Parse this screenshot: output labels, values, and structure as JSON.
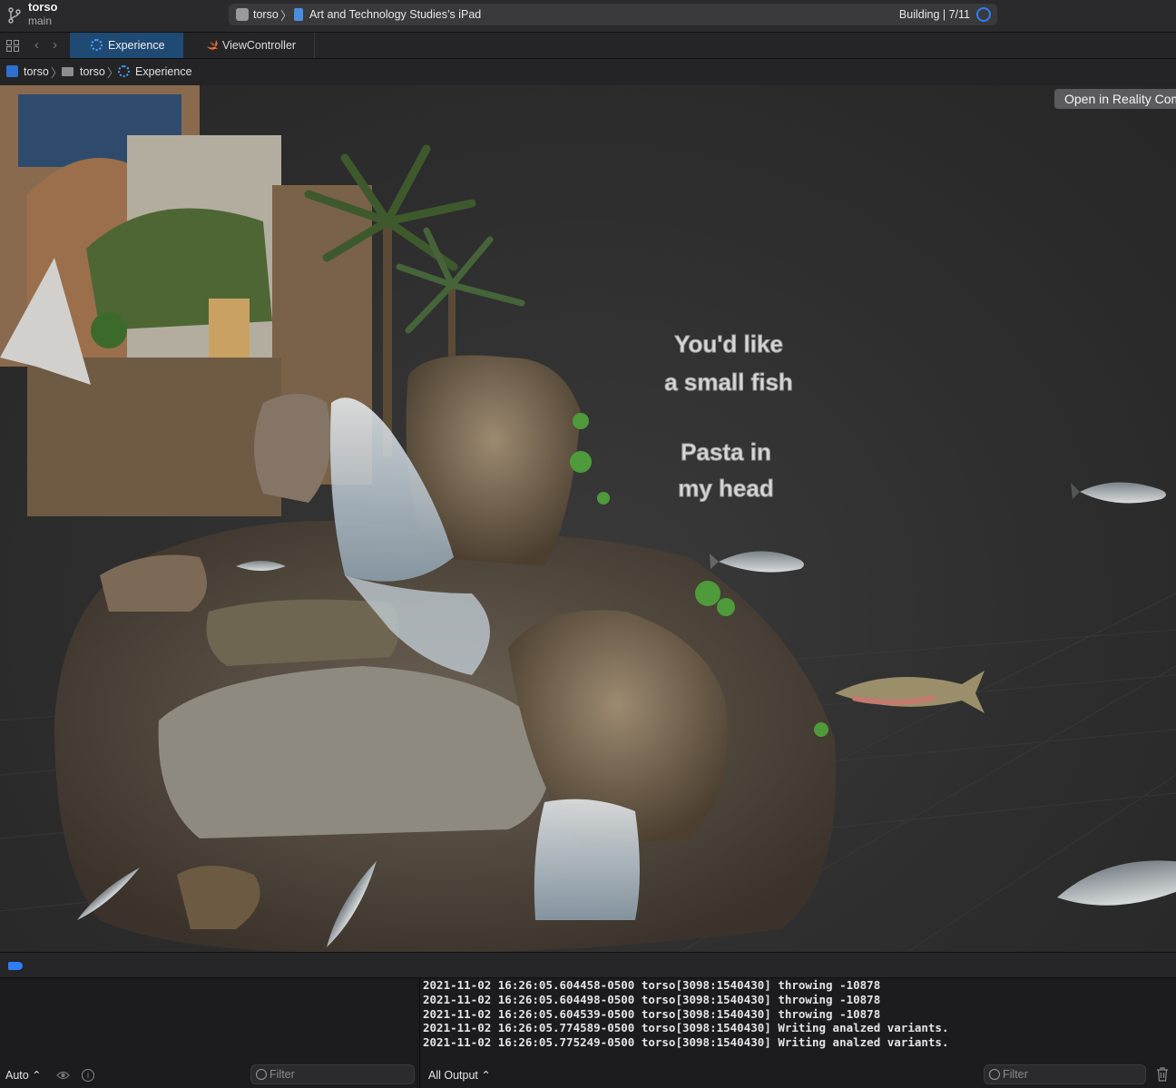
{
  "toolbar": {
    "project_name": "torso",
    "branch": "main",
    "scheme": "torso",
    "device": "Art and Technology Studies’s iPad",
    "build_status": "Building | 7/11"
  },
  "tabs": [
    {
      "label": "Experience",
      "icon": "reality-composer-icon",
      "active": true
    },
    {
      "label": "ViewController",
      "icon": "swift-icon",
      "active": false
    }
  ],
  "breadcrumb": [
    "torso",
    "torso",
    "Experience"
  ],
  "viewport": {
    "open_button_label": "Open in Reality Composer",
    "scene_text": [
      "You'd like",
      "a small fish",
      "Pasta in",
      "my head"
    ]
  },
  "variables_pane": {
    "mode": "Auto ⌃",
    "filter_placeholder": "Filter"
  },
  "console": {
    "lines": [
      "2021-11-02 16:26:05.604458-0500 torso[3098:1540430] throwing -10878",
      "2021-11-02 16:26:05.604498-0500 torso[3098:1540430] throwing -10878",
      "2021-11-02 16:26:05.604539-0500 torso[3098:1540430] throwing -10878",
      "2021-11-02 16:26:05.774589-0500 torso[3098:1540430] Writing analzed variants.",
      "2021-11-02 16:26:05.775249-0500 torso[3098:1540430] Writing analzed variants."
    ],
    "output_mode": "All Output ⌃",
    "filter_placeholder": "Filter"
  },
  "colors": {
    "accent": "#2f7df6",
    "active_tab": "#1f4a74",
    "background": "#1e1e1e"
  }
}
